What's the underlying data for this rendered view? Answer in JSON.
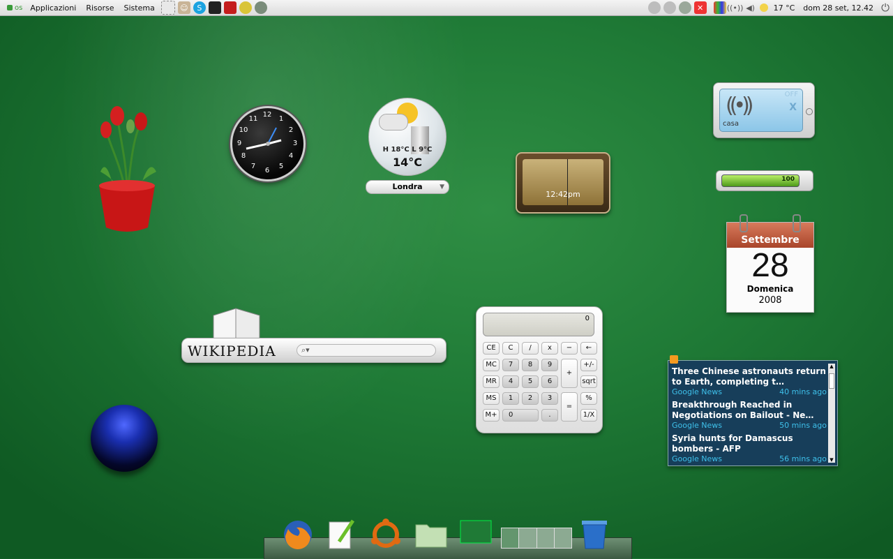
{
  "panel": {
    "os_label": "os",
    "menus": [
      "Applicazioni",
      "Risorse",
      "Sistema"
    ],
    "weather_temp": "17 °C",
    "datetime": "dom 28 set, 12.42"
  },
  "icons": {
    "launchers": [
      "screenshot-icon",
      "users-icon",
      "skype-icon",
      "terminal-icon",
      "app-red-icon",
      "app-globe-icon",
      "app-eye-icon"
    ],
    "tray": [
      "gray-icon-1",
      "gray-icon-2",
      "gray-icon-3",
      "close-red-icon",
      "network-colors-icon",
      "wireless-icon",
      "volume-icon",
      "weather-sun-icon",
      "power-icon"
    ]
  },
  "clock_widget": {
    "numbers": [
      "12",
      "1",
      "2",
      "3",
      "4",
      "5",
      "6",
      "7",
      "8",
      "9",
      "10",
      "11"
    ]
  },
  "weather_widget": {
    "high_low": "H 18°C L 9°C",
    "temp": "14°C",
    "city": "Londra"
  },
  "world_clock": {
    "time": "12:42pm"
  },
  "wifi_widget": {
    "ssid": "casa",
    "state": "OFF",
    "close": "X"
  },
  "battery_widget": {
    "level": 100,
    "label": "100"
  },
  "calendar_widget": {
    "month": "Settembre",
    "day": "28",
    "weekday": "Domenica",
    "year": "2008"
  },
  "wikipedia_widget": {
    "logo": "WIKIPEDIA"
  },
  "calculator": {
    "display": "0",
    "rows": [
      [
        "CE",
        "C",
        "/",
        "x",
        "−",
        "←"
      ],
      [
        "MC",
        "7",
        "8",
        "9",
        "+",
        "+/-"
      ],
      [
        "MR",
        "4",
        "5",
        "6",
        "sqrt"
      ],
      [
        "MS",
        "1",
        "2",
        "3",
        "=",
        "%"
      ],
      [
        "M+",
        "0",
        ".",
        "1/X"
      ]
    ]
  },
  "news_widget": {
    "items": [
      {
        "title": "Three Chinese astronauts return to Earth, completing t…",
        "source": "Google News",
        "age": "40 mins ago"
      },
      {
        "title": "Breakthrough Reached in Negotiations on Bailout - Ne…",
        "source": "Google News",
        "age": "50 mins ago"
      },
      {
        "title": "Syria hunts for Damascus bombers - AFP",
        "source": "Google News",
        "age": "56 mins ago"
      }
    ]
  },
  "dock": {
    "items": [
      "firefox-icon",
      "text-editor-icon",
      "ubuntu-icon",
      "folder-icon",
      "desktop-icon",
      "workspace-switcher",
      "trash-icon"
    ]
  }
}
